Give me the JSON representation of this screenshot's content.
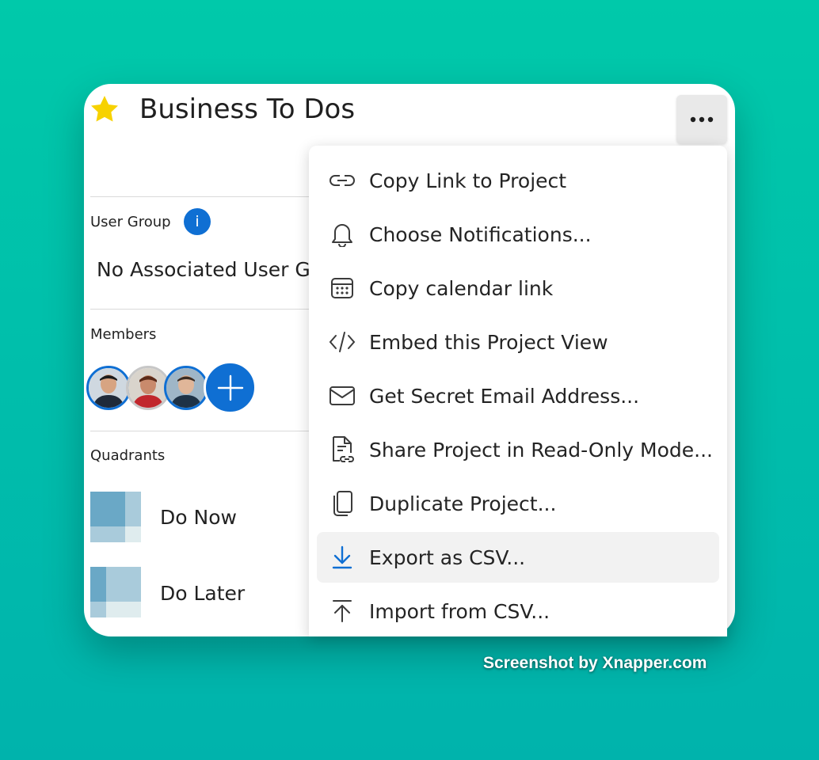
{
  "project": {
    "title": "Business To Dos"
  },
  "user_group": {
    "label": "User Group",
    "info_icon_text": "i",
    "value": "No Associated User G"
  },
  "members": {
    "label": "Members"
  },
  "quadrants": {
    "label": "Quadrants",
    "items": [
      {
        "label": "Do Now"
      },
      {
        "label": "Do Later"
      }
    ]
  },
  "menu": {
    "items": [
      {
        "label": "Copy Link to Project",
        "icon": "link-icon"
      },
      {
        "label": "Choose Notifications...",
        "icon": "bell-icon"
      },
      {
        "label": "Copy calendar link",
        "icon": "calendar-icon"
      },
      {
        "label": "Embed this Project View",
        "icon": "code-icon"
      },
      {
        "label": "Get Secret Email Address...",
        "icon": "mail-icon"
      },
      {
        "label": "Share Project in Read-Only Mode...",
        "icon": "share-document-icon"
      },
      {
        "label": "Duplicate Project...",
        "icon": "duplicate-icon"
      },
      {
        "label": "Export as CSV...",
        "icon": "download-icon"
      },
      {
        "label": "Import from CSV...",
        "icon": "upload-icon"
      }
    ]
  },
  "watermark": "Screenshot by Xnapper.com",
  "colors": {
    "accent": "#0f6fd3",
    "star": "#f7d200",
    "background": "#00bfae"
  }
}
